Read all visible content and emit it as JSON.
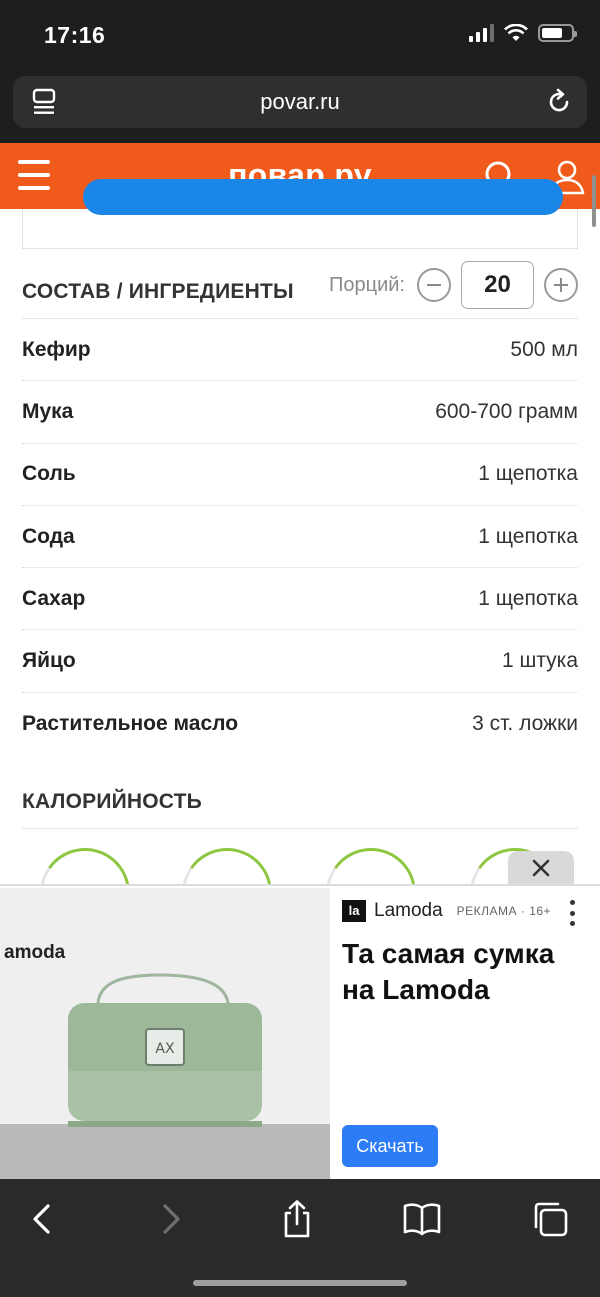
{
  "status_bar": {
    "time": "17:16"
  },
  "browser": {
    "url": "povar.ru"
  },
  "site": {
    "logo": "повар.ру"
  },
  "ingredients": {
    "title": "СОСТАВ / ИНГРЕДИЕНТЫ",
    "portions_label": "Порций:",
    "portions_value": "20",
    "items": [
      {
        "name": "Кефир",
        "amount": "500 мл"
      },
      {
        "name": "Мука",
        "amount": "600-700 грамм"
      },
      {
        "name": "Соль",
        "amount": "1 щепотка"
      },
      {
        "name": "Сода",
        "amount": "1 щепотка"
      },
      {
        "name": "Сахар",
        "amount": "1 щепотка"
      },
      {
        "name": "Яйцо",
        "amount": "1 штука"
      },
      {
        "name": "Растительное масло",
        "amount": "3 ст. ложки"
      }
    ]
  },
  "calories": {
    "title": "КАЛОРИЙНОСТЬ"
  },
  "ad": {
    "logo_text": "la",
    "brand": "Lamoda",
    "tag": "РЕКЛАМА · 16+",
    "image_brand": "amoda",
    "title": "Та самая сумка на Lamoda",
    "button": "Скачать"
  },
  "colors": {
    "brand": "#f05a1a",
    "ad_button": "#2b7cf6",
    "ring": "#8dc63f"
  }
}
